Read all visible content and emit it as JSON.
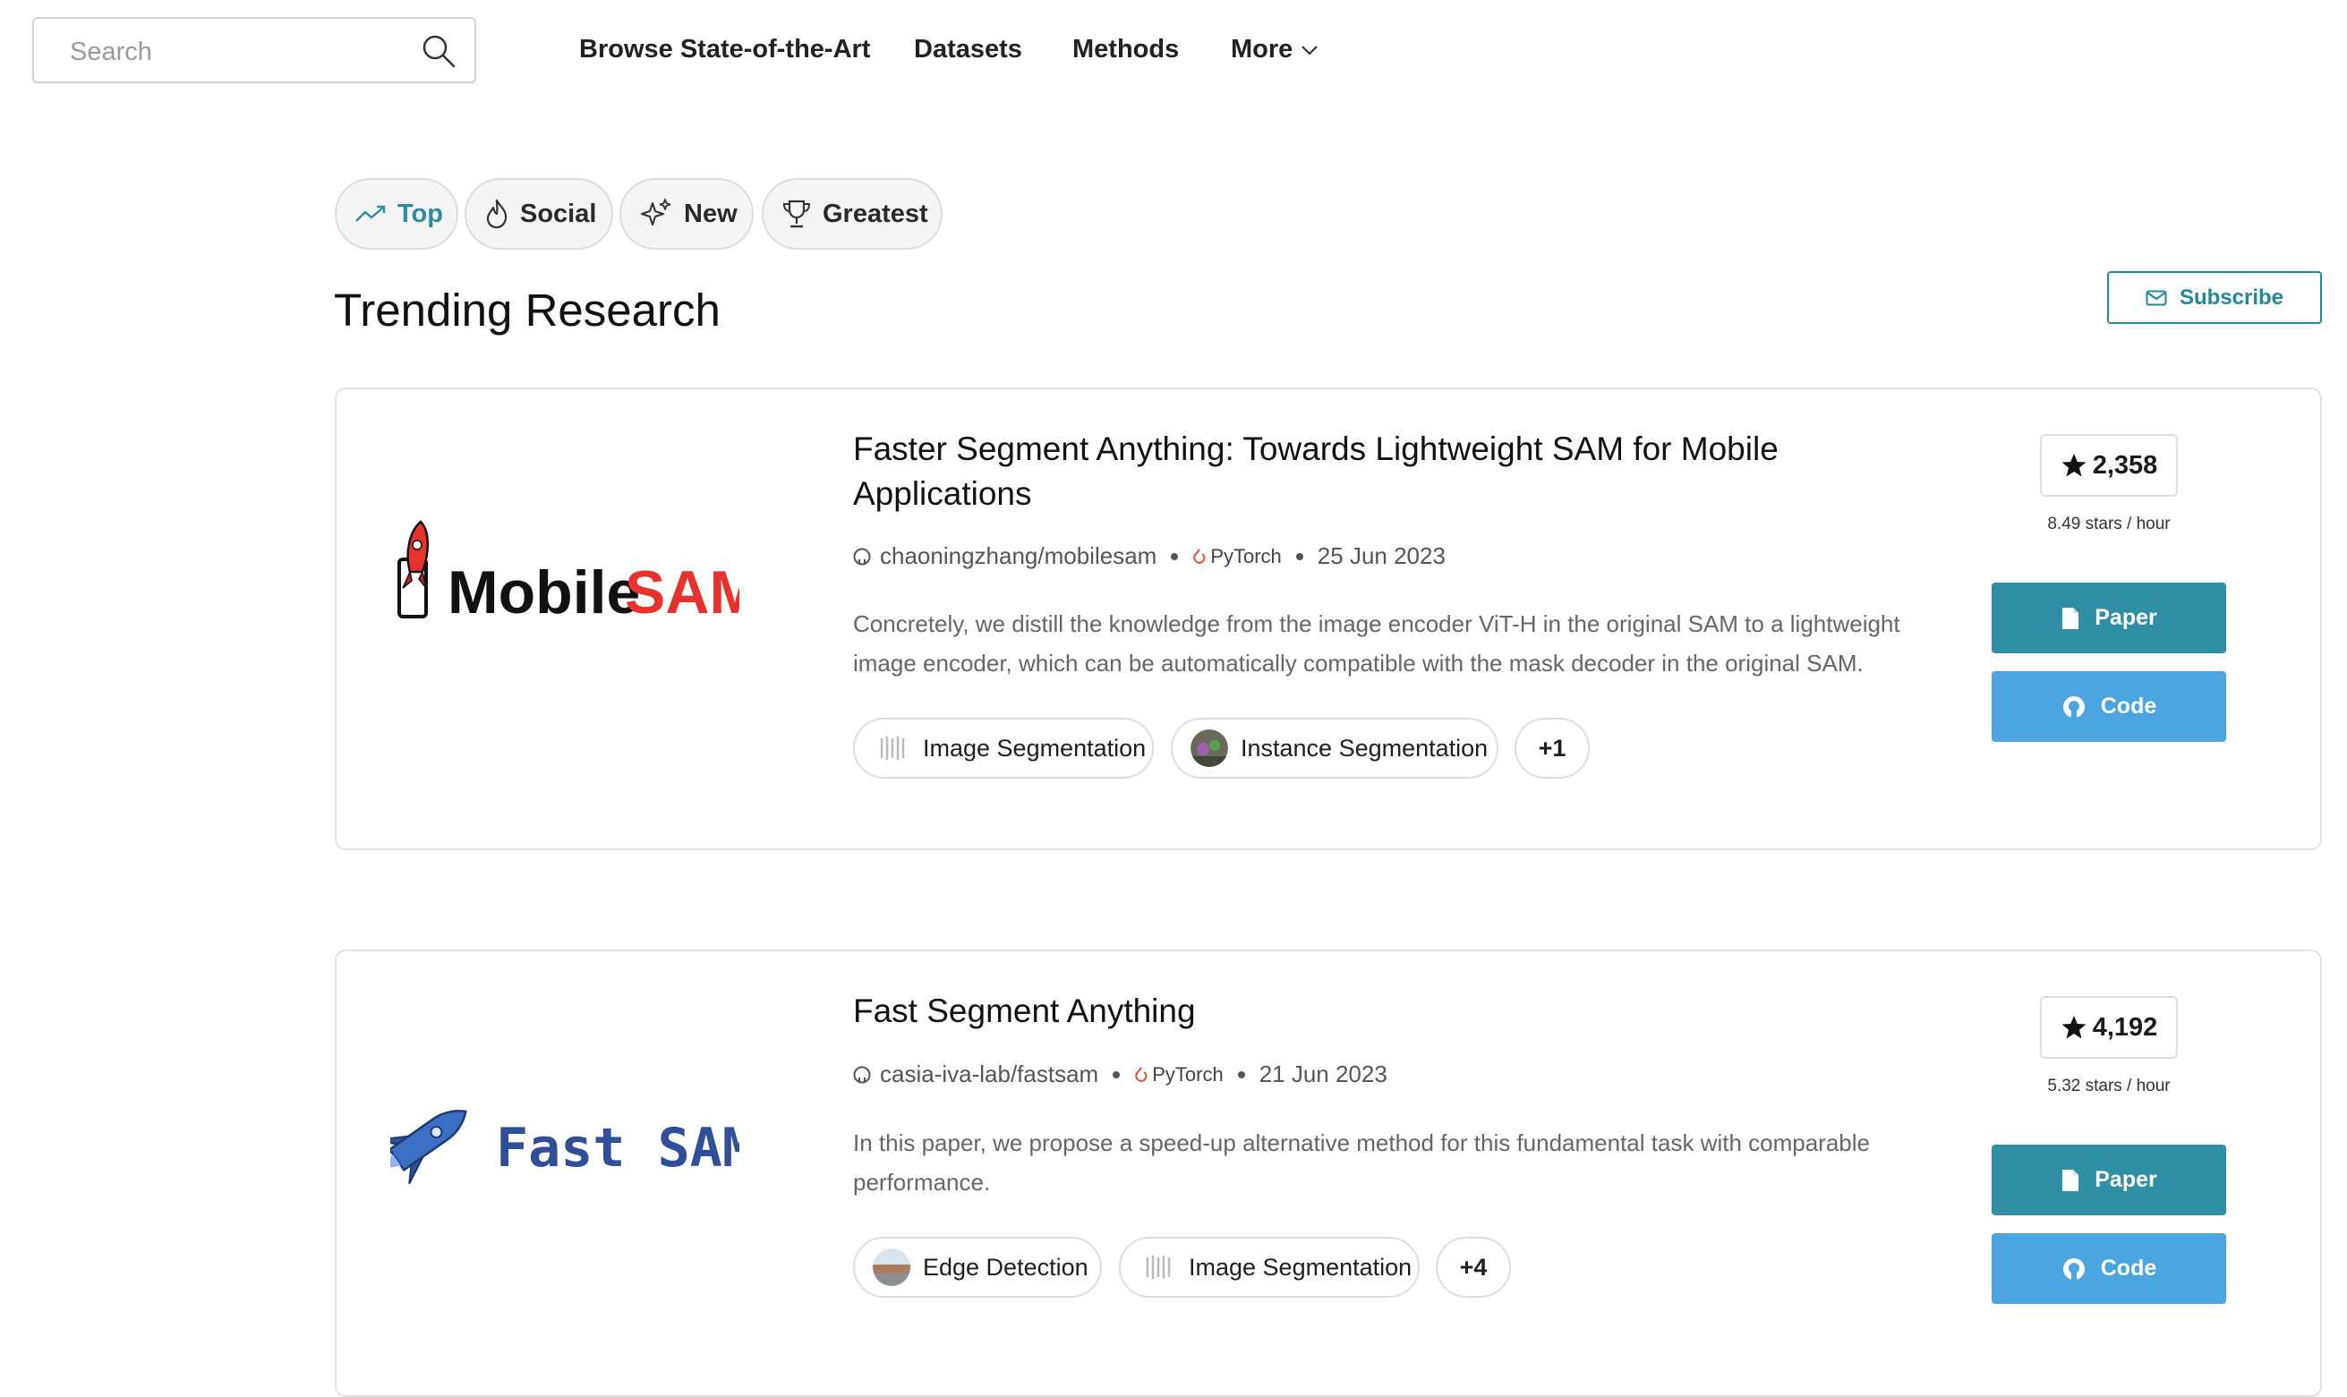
{
  "search": {
    "placeholder": "Search"
  },
  "nav": {
    "items": [
      "Browse State-of-the-Art",
      "Datasets",
      "Methods"
    ],
    "more_label": "More"
  },
  "tabs": [
    {
      "label": "Top",
      "icon": "trending-up-icon",
      "active": true
    },
    {
      "label": "Social",
      "icon": "flame-icon",
      "active": false
    },
    {
      "label": "New",
      "icon": "sparkles-icon",
      "active": false
    },
    {
      "label": "Greatest",
      "icon": "trophy-icon",
      "active": false
    }
  ],
  "section_title": "Trending Research",
  "subscribe_label": "Subscribe",
  "colors": {
    "accent": "#21899b",
    "paper_button": "#2f8fa4",
    "code_button": "#4aa5e0",
    "mobile_sam_red": "#e8322b",
    "fast_sam_blue": "#2f4f9a"
  },
  "papers": [
    {
      "thumbnail_text": [
        "Mobile",
        "SAM"
      ],
      "title": "Faster Segment Anything: Towards Lightweight SAM for Mobile Applications",
      "repo": "chaoningzhang/mobilesam",
      "framework": "PyTorch",
      "date": "25 Jun 2023",
      "abstract": "Concretely, we distill the knowledge from the image encoder ViT-H in the original SAM to a lightweight image encoder, which can be automatically compatible with the mask decoder in the original SAM.",
      "tasks": [
        "Image Segmentation",
        "Instance Segmentation"
      ],
      "more_tasks": "+1",
      "stars": "2,358",
      "stars_rate": "8.49 stars / hour",
      "paper_label": "Paper",
      "code_label": "Code"
    },
    {
      "thumbnail_text": "Fast SAM",
      "title": "Fast Segment Anything",
      "repo": "casia-iva-lab/fastsam",
      "framework": "PyTorch",
      "date": "21 Jun 2023",
      "abstract": "In this paper, we propose a speed-up alternative method for this fundamental task with comparable performance.",
      "tasks": [
        "Edge Detection",
        "Image Segmentation"
      ],
      "more_tasks": "+4",
      "stars": "4,192",
      "stars_rate": "5.32 stars / hour",
      "paper_label": "Paper",
      "code_label": "Code"
    }
  ]
}
